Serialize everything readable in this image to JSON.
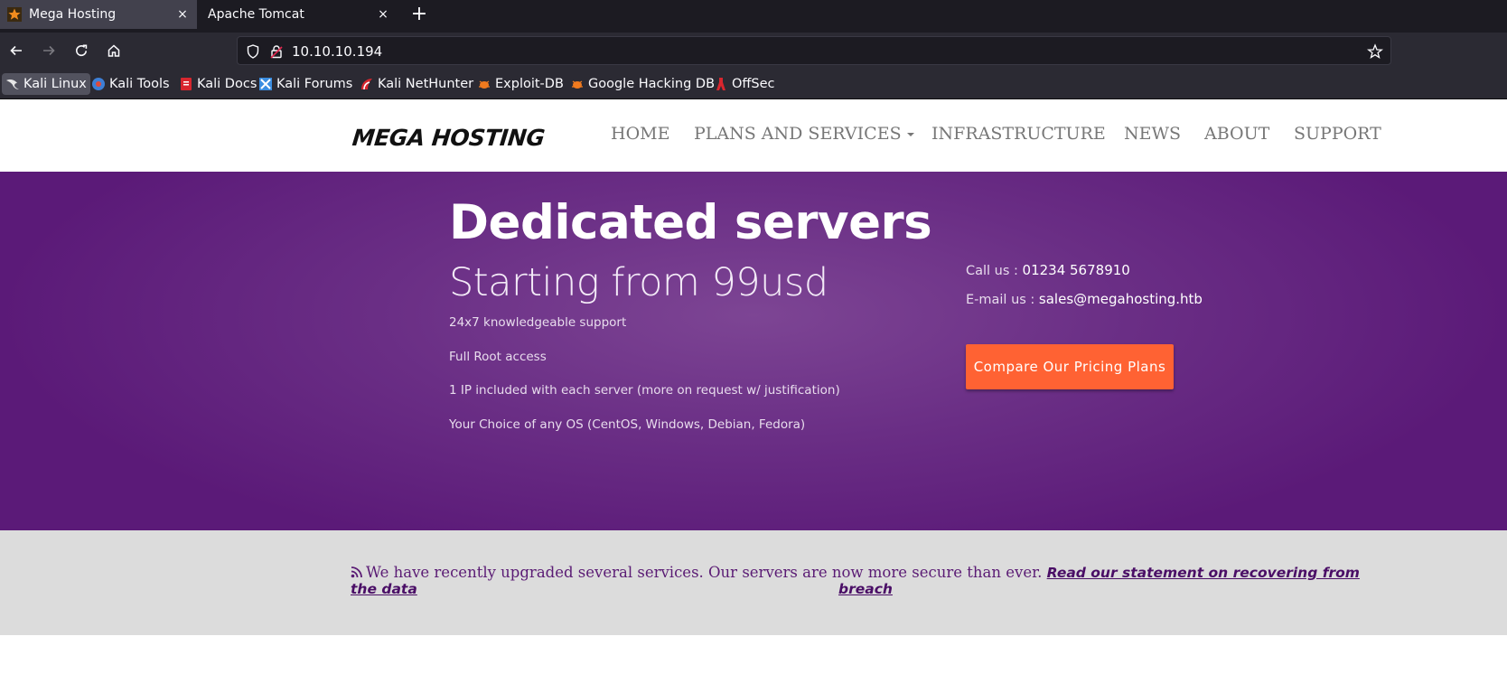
{
  "browser": {
    "tabs": [
      {
        "title": "Mega Hosting",
        "active": true
      },
      {
        "title": "Apache Tomcat",
        "active": false
      }
    ],
    "new_tab_label": "+",
    "close_glyph": "×",
    "url": "10.10.10.194",
    "bookmarks": [
      "Kali Linux",
      "Kali Tools",
      "Kali Docs",
      "Kali Forums",
      "Kali NetHunter",
      "Exploit-DB",
      "Google Hacking DB",
      "OffSec"
    ]
  },
  "site": {
    "logo": "MEGA HOSTING",
    "nav": [
      "HOME",
      "PLANS AND SERVICES",
      "INFRASTRUCTURE",
      "NEWS",
      "ABOUT",
      "SUPPORT"
    ]
  },
  "hero": {
    "title": "Dedicated servers",
    "subtitle": "Starting from 99usd",
    "features": [
      "24x7 knowledgeable support",
      "Full Root access",
      "1 IP included with each server (more on request w/ justification)",
      "Your Choice of any OS (CentOS, Windows, Debian, Fedora)"
    ],
    "call_label": "Call us : ",
    "call_value": "01234 5678910",
    "email_label": "E-mail us : ",
    "email_value": "sales@megahosting.htb",
    "cta_label": "Compare Our Pricing Plans"
  },
  "notice": {
    "text": "We have recently upgraded several services. Our servers are now more secure than ever.",
    "link_part1": "Read our statement on recovering from the data",
    "link_part2": "breach"
  },
  "colors": {
    "hero_purple": "#6a2e85",
    "cta_orange": "#ff6233",
    "notice_bg": "#dcdcdc"
  }
}
